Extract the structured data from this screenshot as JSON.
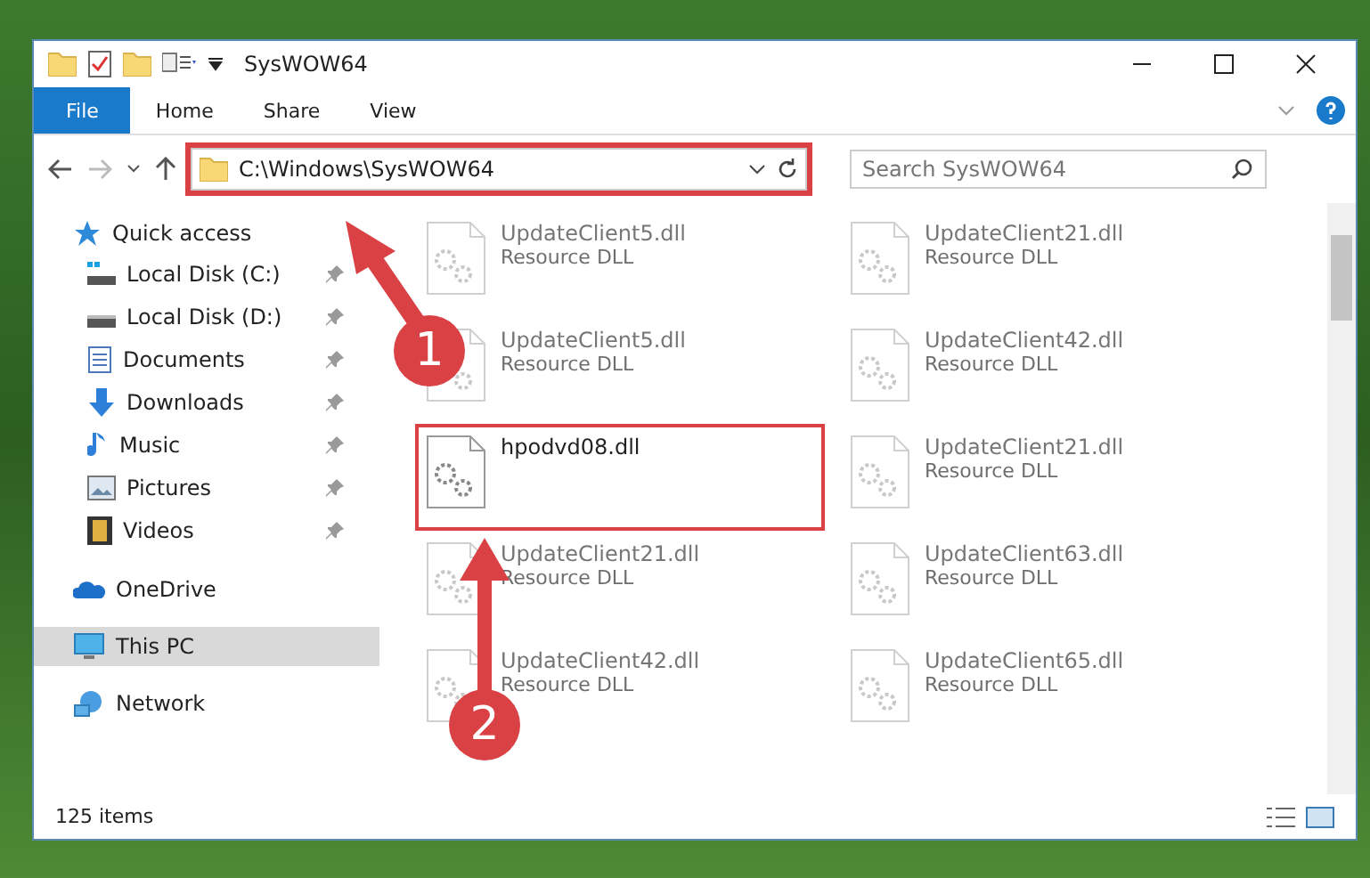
{
  "window": {
    "title": "SysWOW64"
  },
  "ribbon_tabs": [
    {
      "label": "File",
      "kind": "file"
    },
    {
      "label": "Home",
      "kind": "tab"
    },
    {
      "label": "Share",
      "kind": "tab"
    },
    {
      "label": "View",
      "kind": "tab"
    }
  ],
  "address_bar": {
    "path": "C:\\Windows\\SysWOW64",
    "highlighted": true
  },
  "search": {
    "placeholder": "Search SysWOW64"
  },
  "nav": [
    {
      "label": "Quick access",
      "selected": false,
      "children": [
        {
          "label": "Local Disk (C:)",
          "pinned": true,
          "selected": false
        },
        {
          "label": "Local Disk (D:)",
          "pinned": true,
          "selected": false
        },
        {
          "label": "Documents",
          "pinned": true,
          "selected": false
        },
        {
          "label": "Downloads",
          "pinned": true,
          "selected": false
        },
        {
          "label": "Music",
          "pinned": true,
          "selected": false
        },
        {
          "label": "Pictures",
          "pinned": true,
          "selected": false
        },
        {
          "label": "Videos",
          "pinned": true,
          "selected": false
        }
      ]
    },
    {
      "label": "OneDrive",
      "selected": false
    },
    {
      "label": "This PC",
      "selected": true
    },
    {
      "label": "Network",
      "selected": false
    }
  ],
  "files": [
    {
      "name": "UpdateClient5.dll",
      "type": "Resource DLL",
      "dimmed": true,
      "highlighted": false
    },
    {
      "name": "UpdateClient21.dll",
      "type": "Resource DLL",
      "dimmed": true,
      "highlighted": false
    },
    {
      "name": "UpdateClient5.dll",
      "type": "Resource DLL",
      "dimmed": true,
      "highlighted": false
    },
    {
      "name": "UpdateClient42.dll",
      "type": "Resource DLL",
      "dimmed": true,
      "highlighted": false
    },
    {
      "name": "hpodvd08.dll",
      "dimmed": false,
      "highlighted": true
    },
    {
      "name": "UpdateClient21.dll",
      "type": "Resource DLL",
      "dimmed": true,
      "highlighted": false
    },
    {
      "name": "UpdateClient21.dll",
      "type": "Resource DLL",
      "dimmed": true,
      "highlighted": false
    },
    {
      "name": "UpdateClient63.dll",
      "type": "Resource DLL",
      "dimmed": true,
      "highlighted": false
    },
    {
      "name": "UpdateClient42.dll",
      "type": "Resource DLL",
      "dimmed": true,
      "highlighted": false
    },
    {
      "name": "UpdateClient65.dll",
      "type": "Resource DLL",
      "dimmed": true,
      "highlighted": false
    }
  ],
  "status_bar": {
    "item_count": "125 items"
  },
  "annotations": [
    {
      "label": "1",
      "kind": "diagonal"
    },
    {
      "label": "2",
      "kind": "vertical"
    }
  ]
}
